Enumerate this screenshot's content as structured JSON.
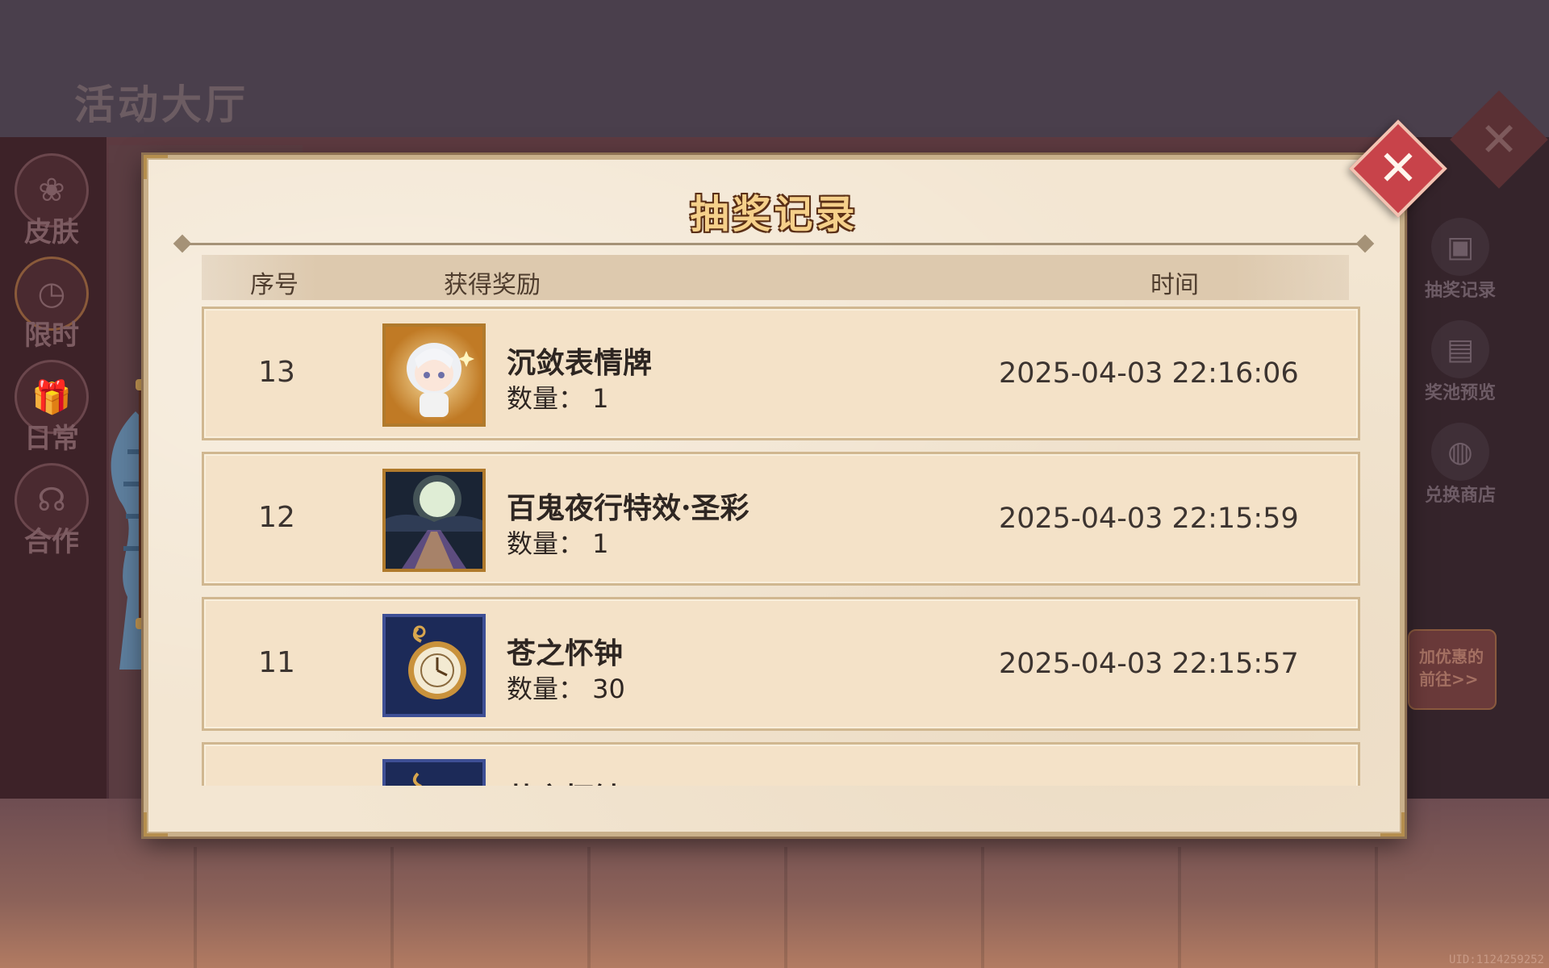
{
  "background": {
    "hall_title": "活动大厅",
    "left_nav": [
      {
        "label": "皮肤",
        "icon": "bow-icon"
      },
      {
        "label": "限时",
        "icon": "clock-icon"
      },
      {
        "label": "日常",
        "icon": "gift-icon"
      },
      {
        "label": "合作",
        "icon": "handshake-icon"
      }
    ],
    "right_menu": [
      {
        "label": "抽奖记录",
        "icon": "gift-box-icon"
      },
      {
        "label": "奖池预览",
        "icon": "document-icon"
      },
      {
        "label": "兑换商店",
        "icon": "cat-shop-icon"
      }
    ],
    "promo_line1": "加优惠的",
    "promo_line2": "前往>>",
    "uid": "UID:1124259252"
  },
  "dialog": {
    "title": "抽奖记录",
    "headers": {
      "index": "序号",
      "reward": "获得奖励",
      "time": "时间"
    },
    "rows": [
      {
        "index": "13",
        "name": "沉敛表情牌",
        "qty": "数量： 1",
        "time": "2025-04-03 22:16:06",
        "thumb": "chibi-character-icon"
      },
      {
        "index": "12",
        "name": "百鬼夜行特效·圣彩",
        "qty": "数量： 1",
        "time": "2025-04-03 22:15:59",
        "thumb": "moon-night-icon"
      },
      {
        "index": "11",
        "name": "苍之怀钟",
        "qty": "数量： 30",
        "time": "2025-04-03 22:15:57",
        "thumb": "pocket-watch-icon"
      },
      {
        "index": "",
        "name": "苍之怀钟",
        "qty": "",
        "time": "",
        "thumb": "pocket-watch-icon"
      }
    ]
  },
  "colors": {
    "accent": "#c8434a",
    "panel": "#f3e6d2",
    "row": "#f4e2c8"
  }
}
